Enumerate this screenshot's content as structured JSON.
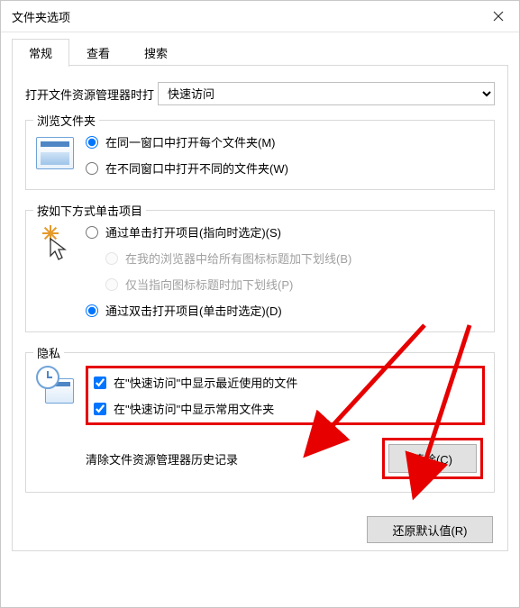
{
  "window": {
    "title": "文件夹选项"
  },
  "tabs": {
    "general": "常规",
    "view": "查看",
    "search": "搜索"
  },
  "open_to": {
    "label": "打开文件资源管理器时打",
    "selected": "快速访问"
  },
  "browse": {
    "title": "浏览文件夹",
    "same_window": "在同一窗口中打开每个文件夹(M)",
    "own_window": "在不同窗口中打开不同的文件夹(W)"
  },
  "click": {
    "title": "按如下方式单击项目",
    "single": "通过单击打开项目(指向时选定)(S)",
    "underline_browser": "在我的浏览器中给所有图标标题加下划线(B)",
    "underline_point": "仅当指向图标标题时加下划线(P)",
    "double": "通过双击打开项目(单击时选定)(D)"
  },
  "privacy": {
    "title": "隐私",
    "recent_files": "在\"快速访问\"中显示最近使用的文件",
    "frequent_folders": "在\"快速访问\"中显示常用文件夹",
    "clear_label": "清除文件资源管理器历史记录",
    "clear_button": "清除(C)"
  },
  "restore_defaults": "还原默认值(R)"
}
